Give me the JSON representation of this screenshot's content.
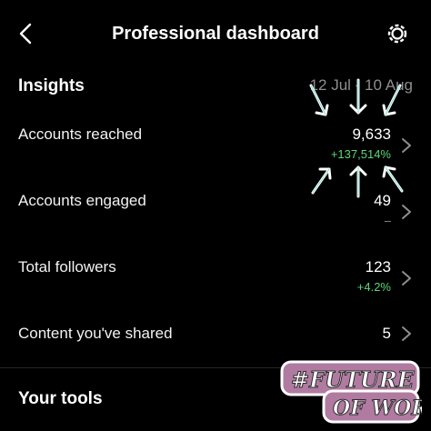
{
  "header": {
    "title": "Professional dashboard",
    "back_icon": "chevron-left-icon",
    "settings_icon": "gear-icon"
  },
  "insights": {
    "title": "Insights",
    "date_range": "12 Jul - 10 Aug",
    "rows": [
      {
        "label": "Accounts reached",
        "value": "9,633",
        "change": "+137,514%",
        "change_color": "#5cd67a"
      },
      {
        "label": "Accounts engaged",
        "value": "49",
        "change": "–",
        "change_color": "#8e8e8e"
      },
      {
        "label": "Total followers",
        "value": "123",
        "change": "+4.2%",
        "change_color": "#5cd67a"
      },
      {
        "label": "Content you've shared",
        "value": "5",
        "change": ""
      }
    ]
  },
  "tools": {
    "title": "Your tools"
  },
  "watermark": {
    "text": "#FUTURE OF WORK",
    "color": "#b07aa1"
  },
  "colors": {
    "background": "#000000",
    "accent_green": "#5cd67a",
    "muted": "#8e8e8e"
  }
}
